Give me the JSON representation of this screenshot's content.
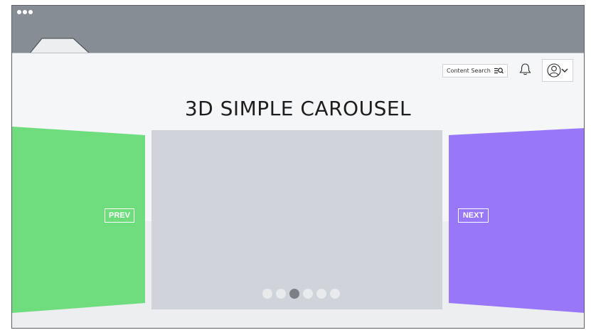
{
  "header": {
    "search_label": "Content Search",
    "search_icon": "search-list-icon",
    "bell_icon": "bell-icon",
    "user_icon": "user-circle-icon",
    "chevron_icon": "chevron-down-icon"
  },
  "carousel": {
    "title": "3D SIMPLE CAROUSEL",
    "prev_label": "PREV",
    "next_label": "NEXT",
    "slide_count": 6,
    "active_index": 2,
    "colors": {
      "left_panel": "#6fdc7d",
      "right_panel": "#9877f8",
      "center_slide": "#cfd4da",
      "indicator": "#e8eaec",
      "indicator_active": "#7c8085"
    }
  },
  "browser": {
    "bar_color": "#878d94"
  }
}
